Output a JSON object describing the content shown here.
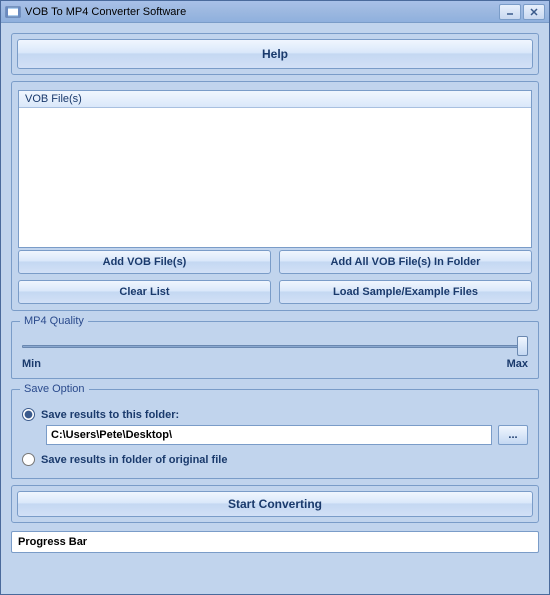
{
  "window": {
    "title": "VOB To MP4 Converter Software"
  },
  "help_label": "Help",
  "listbox": {
    "header": "VOB File(s)"
  },
  "buttons": {
    "add_files": "Add VOB File(s)",
    "add_folder": "Add All VOB File(s) In Folder",
    "clear_list": "Clear List",
    "load_sample": "Load Sample/Example Files"
  },
  "quality": {
    "title": "MP4 Quality",
    "min": "Min",
    "max": "Max"
  },
  "save": {
    "title": "Save Option",
    "opt_folder": "Save results to this folder:",
    "opt_original": "Save results in folder of original file",
    "path": "C:\\Users\\Pete\\Desktop\\",
    "browse": "..."
  },
  "start_label": "Start Converting",
  "progress_label": "Progress Bar"
}
